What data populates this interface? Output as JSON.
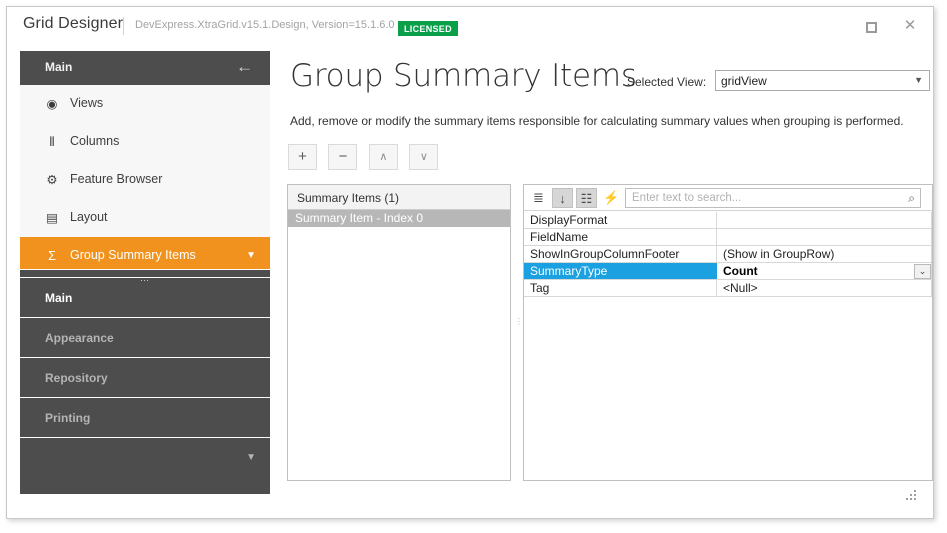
{
  "window": {
    "app_title": "Grid Designer",
    "assembly_info": "DevExpress.XtraGrid.v15.1.Design, Version=15.1.6.0",
    "license_badge": "LICENSED",
    "maximize_label": "□",
    "close_label": "✕",
    "accent_orange": "#f2921e",
    "accent_blue": "#1ba1e2",
    "license_green": "#0aa04a"
  },
  "sidebar": {
    "header_label": "Main",
    "back_arrow": "←",
    "items": [
      {
        "label": "Views",
        "icon": "eye-icon",
        "glyph": "◉",
        "active": false
      },
      {
        "label": "Columns",
        "icon": "columns-icon",
        "glyph": "⦀",
        "active": false
      },
      {
        "label": "Feature Browser",
        "icon": "gear-icon",
        "glyph": "⚙",
        "active": false
      },
      {
        "label": "Layout",
        "icon": "layout-icon",
        "glyph": "▤",
        "active": false
      },
      {
        "label": "Group Summary Items",
        "icon": "sigma-icon",
        "glyph": "Σ",
        "active": true
      }
    ],
    "active_chevron": "▼",
    "sections": [
      {
        "label": "Main",
        "current": true
      },
      {
        "label": "Appearance",
        "current": false
      },
      {
        "label": "Repository",
        "current": false
      },
      {
        "label": "Printing",
        "current": false
      }
    ],
    "more_chevron": "▼"
  },
  "main": {
    "page_title": "Group Summary Items",
    "selected_view_label": "Selected View:",
    "selected_view_value": "gridView",
    "selected_view_arrow": "▼",
    "description": "Add, remove or modify the summary items responsible for calculating summary values when grouping is performed.",
    "toolbar": [
      {
        "name": "add-summary-item-button",
        "glyph": "+"
      },
      {
        "name": "remove-summary-item-button",
        "glyph": "−"
      },
      {
        "name": "move-up-button",
        "glyph": "∧"
      },
      {
        "name": "move-down-button",
        "glyph": "∨"
      }
    ],
    "list_panel": {
      "header": "Summary Items (1)",
      "rows": [
        {
          "label": "Summary Item - Index 0",
          "selected": true
        }
      ]
    },
    "splitter_dots": "⋮",
    "property_grid": {
      "toolbar": [
        {
          "name": "categorized-icon",
          "glyph": "≣",
          "pressed": false
        },
        {
          "name": "sort-alphabetical-icon",
          "glyph": "↓",
          "pressed": true
        },
        {
          "name": "properties-page-icon",
          "glyph": "☷",
          "pressed": true
        },
        {
          "name": "events-lightning-icon",
          "glyph": "⚡",
          "pressed": false
        }
      ],
      "search_placeholder": "Enter text to search...",
      "search_value": "",
      "search_icon": "⌕",
      "rows": [
        {
          "name": "DisplayFormat",
          "value": "",
          "selected": false,
          "editor": false
        },
        {
          "name": "FieldName",
          "value": "",
          "selected": false,
          "editor": false
        },
        {
          "name": "ShowInGroupColumnFooter",
          "value": "(Show in GroupRow)",
          "selected": false,
          "editor": false
        },
        {
          "name": "SummaryType",
          "value": "Count",
          "selected": true,
          "editor": true
        },
        {
          "name": "Tag",
          "value": "<Null>",
          "selected": false,
          "editor": false
        }
      ],
      "editor_arrow": "⌄"
    }
  }
}
